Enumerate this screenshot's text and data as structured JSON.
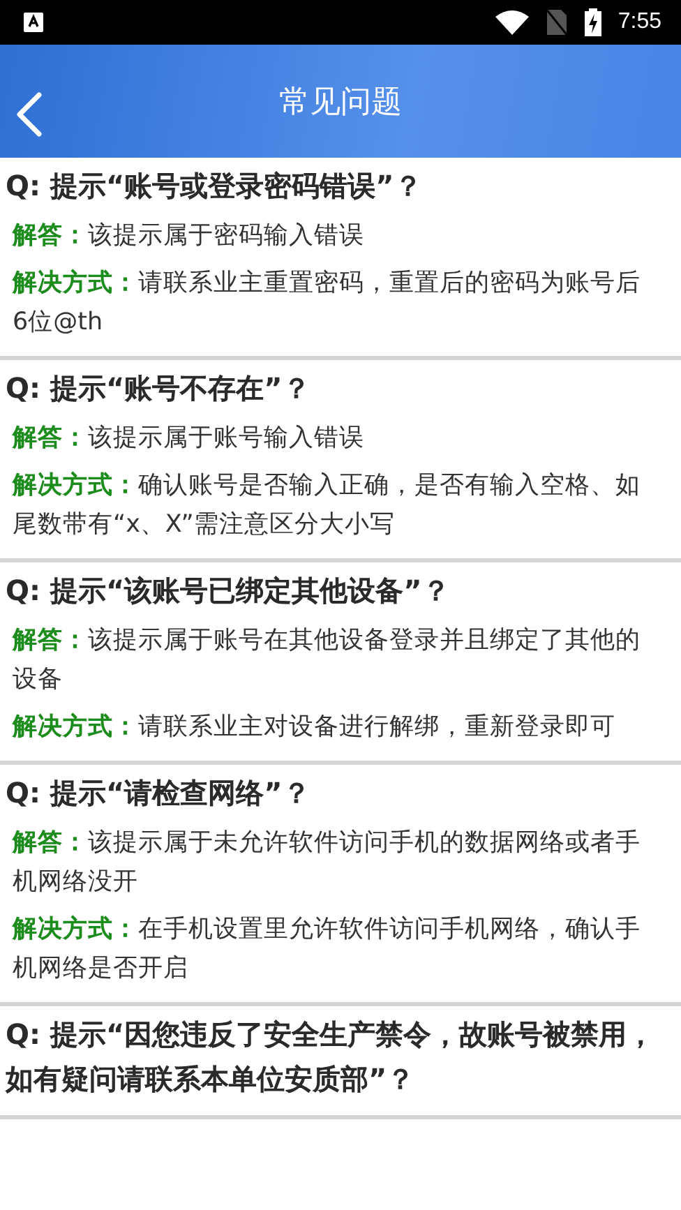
{
  "status_bar": {
    "time": "7:55"
  },
  "header": {
    "title": "常见问题"
  },
  "faqs": [
    {
      "question": "Q: 提示“账号或登录密码错误”？",
      "answers": [
        {
          "label": "解答：",
          "text": "该提示属于密码输入错误"
        },
        {
          "label": "解决方式：",
          "text": "请联系业主重置密码，重置后的密码为账号后6位@th"
        }
      ]
    },
    {
      "question": "Q: 提示“账号不存在”？",
      "answers": [
        {
          "label": "解答：",
          "text": "该提示属于账号输入错误"
        },
        {
          "label": "解决方式：",
          "text": "确认账号是否输入正确，是否有输入空格、如尾数带有“x、X”需注意区分大小写"
        }
      ]
    },
    {
      "question": "Q: 提示“该账号已绑定其他设备”？",
      "answers": [
        {
          "label": "解答：",
          "text": "该提示属于账号在其他设备登录并且绑定了其他的设备"
        },
        {
          "label": "解决方式：",
          "text": "请联系业主对设备进行解绑，重新登录即可"
        }
      ]
    },
    {
      "question": "Q: 提示“请检查网络”？",
      "answers": [
        {
          "label": "解答：",
          "text": "该提示属于未允许软件访问手机的数据网络或者手机网络没开"
        },
        {
          "label": "解决方式：",
          "text": "在手机设置里允许软件访问手机网络，确认手机网络是否开启"
        }
      ]
    },
    {
      "question": "Q: 提示“因您违反了安全生产禁令，故账号被禁用，如有疑问请联系本单位安质部”？"
    }
  ]
}
